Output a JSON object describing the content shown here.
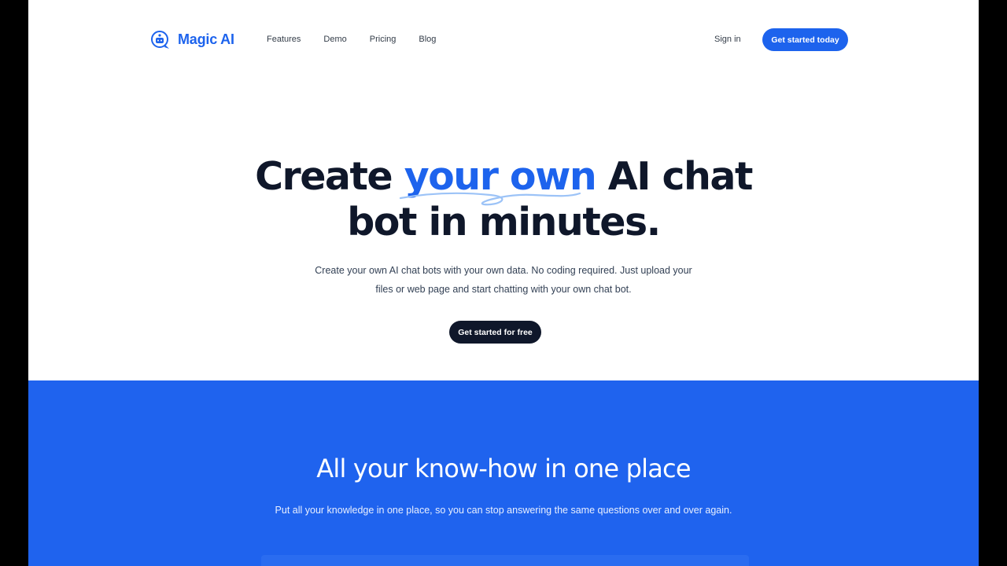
{
  "brand": {
    "name": "Magic AI",
    "icon": "chat-bubble-robot-icon",
    "color": "#1d63ed"
  },
  "nav": {
    "items": [
      "Features",
      "Demo",
      "Pricing",
      "Blog"
    ],
    "sign_in": "Sign in",
    "cta": "Get started today"
  },
  "hero": {
    "title_before": "Create ",
    "title_highlight": "your own",
    "title_after_line1": " AI chat",
    "title_line2": "bot in minutes.",
    "subtitle": "Create your own AI chat bots with your own data. No coding required. Just upload your files or web page and start chatting with your own chat bot.",
    "cta": "Get started for free"
  },
  "features": {
    "title": "All your know-how in one place",
    "subtitle": "Put all your knowledge in one place, so you can stop answering the same questions over and over again."
  },
  "colors": {
    "accent": "#1d63ed",
    "dark": "#0f172a",
    "section_bg": "#1f63ee"
  }
}
